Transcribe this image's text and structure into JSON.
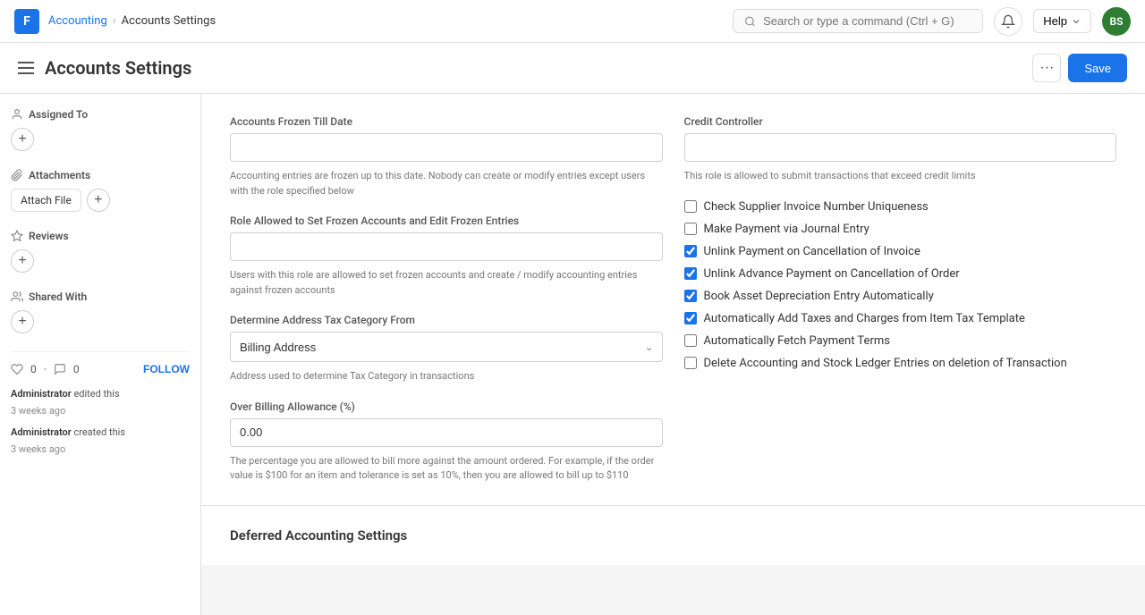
{
  "app": {
    "logo_text": "F",
    "breadcrumb": [
      "Accounting",
      "Accounts Settings"
    ],
    "search_placeholder": "Search or type a command (Ctrl + G)",
    "avatar_initials": "BS",
    "avatar_bg": "#2e7d32"
  },
  "header": {
    "title": "Accounts Settings",
    "btn_more_label": "···",
    "btn_save_label": "Save"
  },
  "sidebar": {
    "assigned_to_label": "Assigned To",
    "attachments_label": "Attachments",
    "attach_file_label": "Attach File",
    "reviews_label": "Reviews",
    "shared_with_label": "Shared With",
    "likes_count": "0",
    "comments_count": "0",
    "follow_label": "FOLLOW",
    "log_items": [
      {
        "user": "Administrator",
        "action": "edited this",
        "time": "3 weeks ago"
      },
      {
        "user": "Administrator",
        "action": "created this",
        "time": "3 weeks ago"
      }
    ]
  },
  "main": {
    "accounts_frozen_label": "Accounts Frozen Till Date",
    "accounts_frozen_value": "",
    "accounts_frozen_hint": "Accounting entries are frozen up to this date. Nobody can create or modify entries except users with the role specified below",
    "role_frozen_label": "Role Allowed to Set Frozen Accounts and Edit Frozen Entries",
    "role_frozen_value": "",
    "role_frozen_hint": "Users with this role are allowed to set frozen accounts and create / modify accounting entries against frozen accounts",
    "address_tax_label": "Determine Address Tax Category From",
    "address_tax_value": "Billing Address",
    "address_tax_hint": "Address used to determine Tax Category in transactions",
    "over_billing_label": "Over Billing Allowance (%)",
    "over_billing_value": "0.00",
    "over_billing_hint": "The percentage you are allowed to bill more against the amount ordered. For example, if the order value is $100 for an item and tolerance is set as 10%, then you are allowed to bill up to $110",
    "credit_controller_label": "Credit Controller",
    "credit_controller_value": "",
    "credit_controller_hint": "This role is allowed to submit transactions that exceed credit limits",
    "checkboxes": [
      {
        "label": "Check Supplier Invoice Number Uniqueness",
        "checked": false
      },
      {
        "label": "Make Payment via Journal Entry",
        "checked": false
      },
      {
        "label": "Unlink Payment on Cancellation of Invoice",
        "checked": true
      },
      {
        "label": "Unlink Advance Payment on Cancellation of Order",
        "checked": true
      },
      {
        "label": "Book Asset Depreciation Entry Automatically",
        "checked": true
      },
      {
        "label": "Automatically Add Taxes and Charges from Item Tax Template",
        "checked": true
      },
      {
        "label": "Automatically Fetch Payment Terms",
        "checked": false
      },
      {
        "label": "Delete Accounting and Stock Ledger Entries on deletion of Transaction",
        "checked": false
      }
    ],
    "deferred_title": "Deferred Accounting Settings"
  },
  "help_label": "Help",
  "nav_items": [
    "Accounting",
    "Accounts Settings"
  ]
}
